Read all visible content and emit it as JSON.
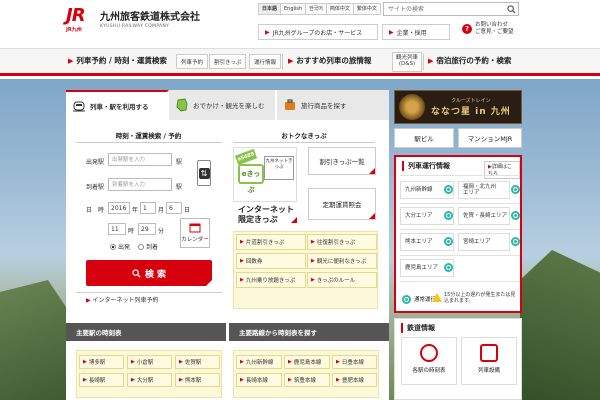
{
  "header": {
    "logo_text": "JR",
    "logo_sub": "JR九州",
    "company_ja": "九州旅客鉄道株式会社",
    "company_en": "KYUSHU RAILWAY COMPANY",
    "languages": [
      "日本語",
      "English",
      "한국어",
      "简体中文",
      "繁体中文"
    ],
    "search_placeholder": "サイトの検索",
    "group_link": "JR九州グループのお店・サービス",
    "recruit_link": "企業・採用",
    "contact_line1": "お問い合わせ",
    "contact_line2": "ご意見・ご要望"
  },
  "nav": {
    "item1": "列車予約 / 時刻・運賃検索",
    "sub1": "列車予約",
    "sub2": "割引きっぷ",
    "sub3": "運行情報",
    "item2": "おすすめ列車の旅情報",
    "sub4_line1": "観光列車",
    "sub4_line2": "(D&S)",
    "item3": "宿泊旅行の予約・検索"
  },
  "tabs": [
    {
      "label": "列車・駅を利用する"
    },
    {
      "label": "おでかけ・観光を楽しむ"
    },
    {
      "label": "旅行商品を探す"
    }
  ],
  "search_form": {
    "section_title": "時刻・運賃検索 / 予約",
    "from_label": "出発駅",
    "from_placeholder": "出発駅を入力",
    "to_label": "到着駅",
    "to_placeholder": "到着駅を入力",
    "station_suffix": "駅",
    "date_label": "日　時",
    "year": "2016",
    "year_unit": "年",
    "month": "1",
    "month_unit": "月",
    "day": "6",
    "day_unit": "日",
    "hour": "11",
    "hour_unit": "時",
    "minute": "29",
    "minute_unit": "分",
    "depart_label": "出発",
    "arrive_label": "到着",
    "calendar_label": "カレンダー",
    "search_button": "検 索",
    "internet_reserve": "インターネット列車予約"
  },
  "deals": {
    "section_title": "おトクなきっぷ",
    "tag": "e5489",
    "ecard": "eきっぷ",
    "netcard": "九州ネットきっぷ",
    "internet_limited_line1": "インターネット",
    "internet_limited_line2": "限定きっぷ",
    "discount_list": "割引きっぷ一覧",
    "commuter": "定期運賃照会",
    "buttons": [
      "片道割引きっぷ",
      "往復割引きっぷ",
      "回数券",
      "観光に便利なきっぷ",
      "九州乗り放題きっぷ",
      "きっぷのルール"
    ]
  },
  "station_timetable": {
    "title": "主要駅の時刻表",
    "stations": [
      "博多駅",
      "小倉駅",
      "佐賀駅",
      "長崎駅",
      "大分駅",
      "熊本駅"
    ]
  },
  "line_timetable": {
    "title": "主要路線から時刻表を探す",
    "lines": [
      "九州新幹線",
      "鹿児島本線",
      "日豊本線",
      "長崎本線",
      "筑豊本線",
      "豊肥本線"
    ]
  },
  "right": {
    "nanatsu_small": "クルーズトレイン",
    "nanatsu_big": "ななつ星 in 九州",
    "station_building": "駅ビル",
    "mansion": "マンションMJR"
  },
  "status": {
    "title": "列車運行情報",
    "legend_button": "詳細はこちら",
    "areas": [
      {
        "label": "九州新幹線"
      },
      {
        "label": "福岡・北九州エリア"
      },
      {
        "label": "大分エリア"
      },
      {
        "label": "佐賀・長崎エリア"
      },
      {
        "label": "熊本エリア"
      },
      {
        "label": "宮崎エリア"
      },
      {
        "label": "鹿児島エリア"
      }
    ],
    "normal_label": "通常運行",
    "warning_text": "15分以上の遅れが発生または見込まれます。"
  },
  "rail_info": {
    "title": "鉄道情報",
    "timetable": "各駅の時刻表",
    "trains": "列車設備"
  },
  "colors": {
    "brand_red": "#d7000f",
    "status_green": "#2bb9a6",
    "accent_yellow": "#fdf8d8"
  }
}
